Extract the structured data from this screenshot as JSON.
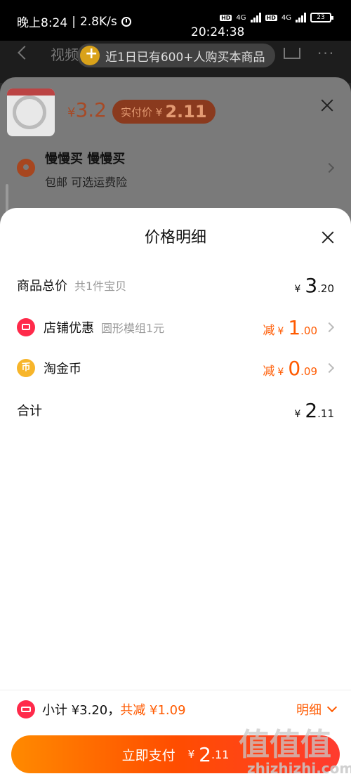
{
  "status_bar": {
    "time_text": "晚上8:24",
    "speed": "2.8K/s",
    "net_badge": "HD",
    "network": "4G",
    "battery": "23",
    "clock": "20:24:38"
  },
  "header": {
    "video_tab": "视频",
    "buyers_banner": "近1日已有600+人购买本商品"
  },
  "sku_panel": {
    "price_yen": "¥",
    "price": "3.2",
    "actual_price_label": "实付价 ¥",
    "actual_price": "2.11",
    "shipping_title": "慢慢买 慢慢买",
    "shipping_sub": "包邮 可选运费险"
  },
  "price_detail": {
    "title": "价格明细",
    "rows": [
      {
        "label": "商品总价",
        "sub": "共1件宝贝",
        "prefix": "",
        "yen": "¥",
        "int": "3",
        "dec": ".20"
      },
      {
        "label": "店铺优惠",
        "sub": "圆形模组1元",
        "prefix": "减",
        "yen": "¥",
        "int": "1",
        "dec": ".00"
      },
      {
        "label": "淘金币",
        "sub": "",
        "prefix": "减",
        "yen": "¥",
        "int": "0",
        "dec": ".09"
      },
      {
        "label": "合计",
        "sub": "",
        "prefix": "",
        "yen": "¥",
        "int": "2",
        "dec": ".11"
      }
    ],
    "coin_glyph": "币"
  },
  "bottom_bar": {
    "subtotal": "小计 ¥3.20，",
    "discount": "共减 ¥1.09",
    "detail_label": "明细",
    "pay_label": "立即支付",
    "pay_yen": "¥",
    "pay_int": "2",
    "pay_dec": ".11"
  },
  "watermark": {
    "mark": "值值值",
    "url": "zhizhizhi.com"
  },
  "colors": {
    "accent": "#ff5a00",
    "shop_icon": "#ff2a4a",
    "coin_icon": "#f7b52a"
  },
  "icons": [
    "clock-icon",
    "signal-icon",
    "battery-icon",
    "back-icon",
    "cart-icon",
    "more-icon",
    "close-icon",
    "location-icon",
    "shop-icon",
    "coin-icon",
    "ticket-icon",
    "chevron-down-icon",
    "chevron-right-icon"
  ]
}
